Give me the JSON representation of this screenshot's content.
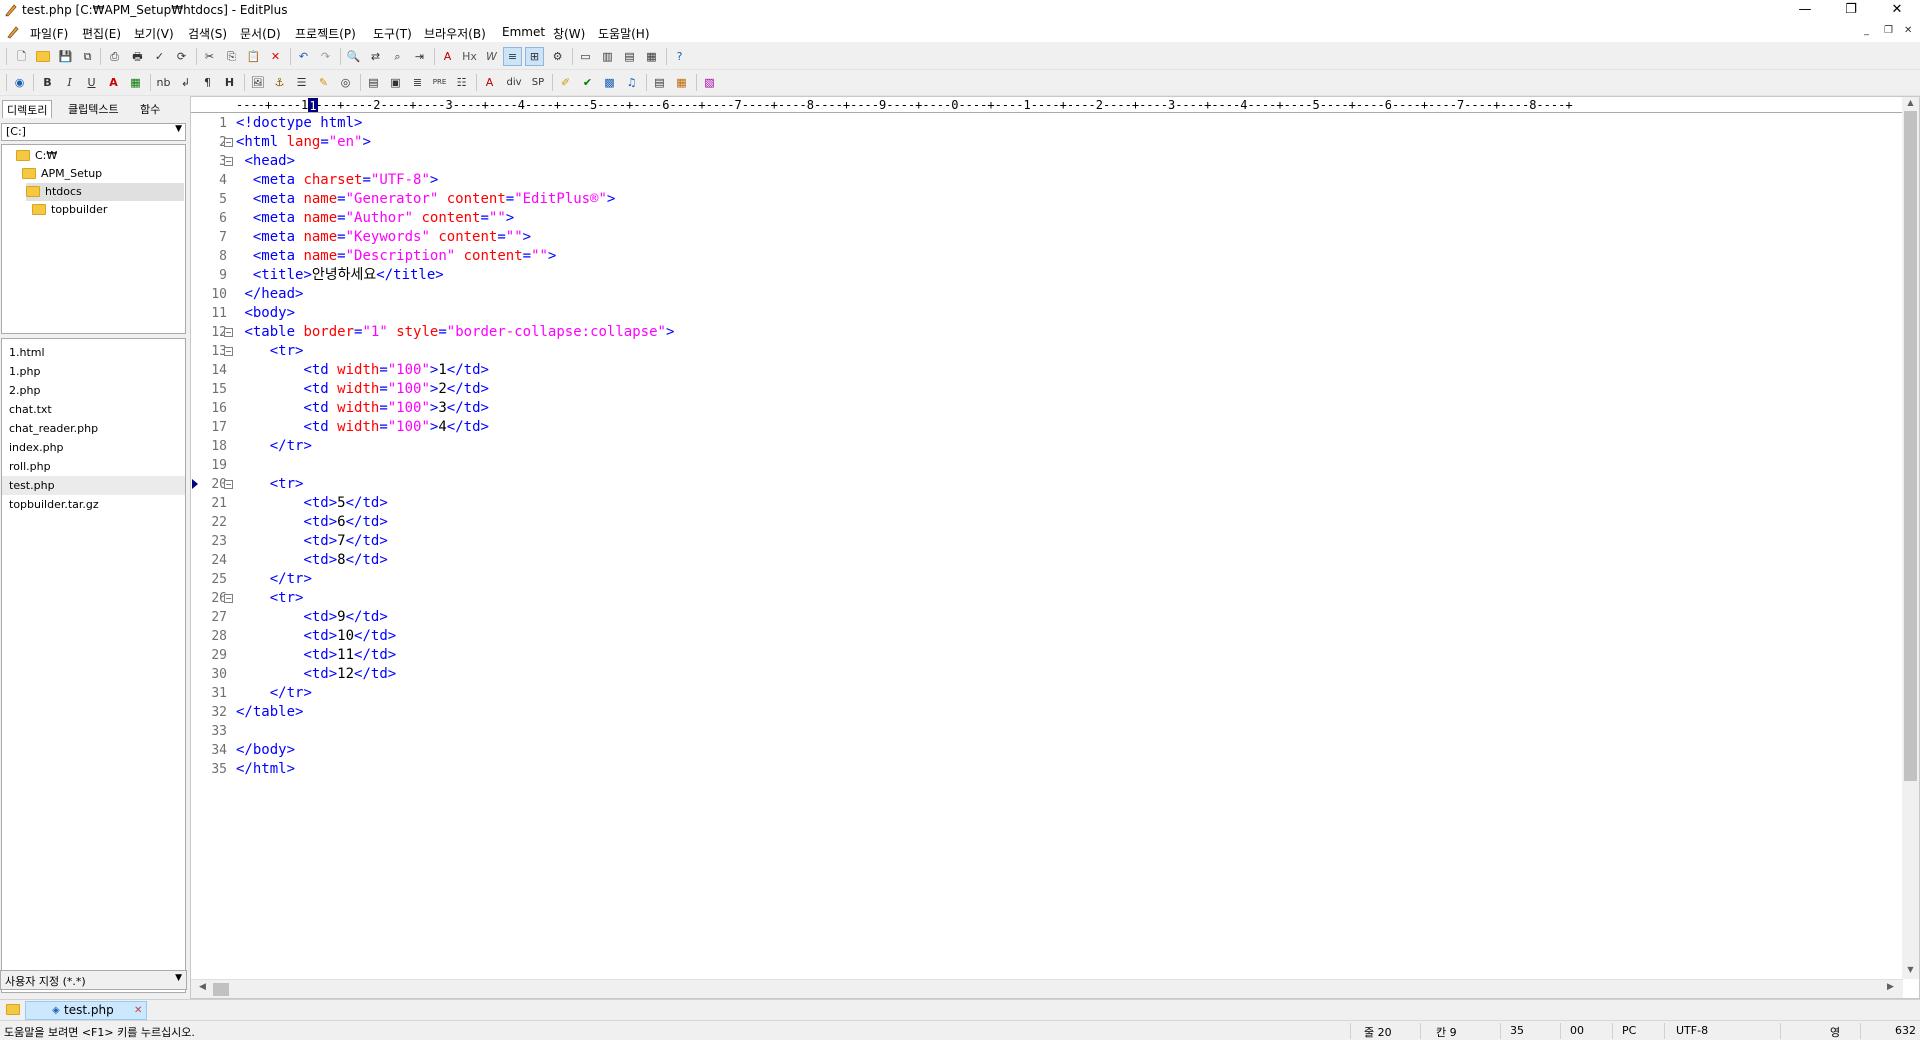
{
  "window": {
    "title": "test.php [C:₩APM_Setup₩htdocs] - EditPlus",
    "minimize": "—",
    "restore": "❐",
    "close": "✕"
  },
  "menu": [
    "파일(F)",
    "편집(E)",
    "보기(V)",
    "검색(S)",
    "문서(D)",
    "프로젝트(P)",
    "도구(T)",
    "브라우저(B)",
    "Emmet",
    "창(W)",
    "도움말(H)"
  ],
  "mdi_controls": [
    "_",
    "❐",
    "✕"
  ],
  "toolbar1_icons": [
    "new-file-icon",
    "open-file-icon",
    "save-icon",
    "save-all-icon",
    "print-preview-icon",
    "print-icon",
    "spell-check-icon",
    "sync-icon",
    "cut-icon",
    "copy-icon",
    "paste-icon",
    "delete-icon",
    "undo-icon",
    "redo-icon",
    "find-icon",
    "replace-icon",
    "find-in-files-icon",
    "go-to-icon",
    "font-icon",
    "hex-icon",
    "word-wrap-icon",
    "line-number-icon",
    "column-mode-icon",
    "settings-icon",
    "browser-icon",
    "window-split-icon",
    "cliptext-window-icon",
    "output-window-icon",
    "full-screen-icon",
    "help-icon"
  ],
  "toolbar2": {
    "bold": "B",
    "italic": "I",
    "underline": "U",
    "font_color": "A",
    "nbsp": "nb",
    "pilcrow": "¶",
    "heading": "H",
    "div": "div",
    "sp": "SP",
    "pre": "PRE"
  },
  "left_tabs": [
    "디렉토리",
    "클립텍스트",
    "함수"
  ],
  "drive": "[C:]",
  "tree": [
    "C:₩",
    "APM_Setup",
    "htdocs",
    "topbuilder"
  ],
  "files": [
    "1.html",
    "1.php",
    "2.php",
    "chat.txt",
    "chat_reader.php",
    "index.php",
    "roll.php",
    "test.php",
    "topbuilder.tar.gz"
  ],
  "selected_file": "test.php",
  "filter": "사용자 지정 (*.*)",
  "ruler": "----+----1----+----2----+----3----+----4----+----5----+----6----+----7----+----8----+----9----+----0----+----1----+----2----+----3----+----4----+----5----+----6----+----7----+----8----+",
  "ruler_cursor": "1",
  "code_lines": [
    "<!doctype html>",
    "<html lang=\"en\">",
    " <head>",
    "  <meta charset=\"UTF-8\">",
    "  <meta name=\"Generator\" content=\"EditPlus®\">",
    "  <meta name=\"Author\" content=\"\">",
    "  <meta name=\"Keywords\" content=\"\">",
    "  <meta name=\"Description\" content=\"\">",
    "  <title>안녕하세요</title>",
    " </head>",
    " <body>",
    " <table border=\"1\" style=\"border-collapse:collapse\">",
    "    <tr>",
    "        <td width=\"100\">1</td>",
    "        <td width=\"100\">2</td>",
    "        <td width=\"100\">3</td>",
    "        <td width=\"100\">4</td>",
    "    </tr>",
    "",
    "    <tr>",
    "        <td>5</td>",
    "        <td>6</td>",
    "        <td>7</td>",
    "        <td>8</td>",
    "    </tr>",
    "    <tr>",
    "        <td>9</td>",
    "        <td>10</td>",
    "        <td>11</td>",
    "        <td>12</td>",
    "    </tr>",
    "</table>",
    "",
    "</body>",
    "</html>"
  ],
  "fold_lines": [
    2,
    3,
    12,
    13,
    20,
    26
  ],
  "current_line": 20,
  "doc_tab": "test.php",
  "status": {
    "help": "도움말을 보려면 <F1> 키를 누르십시오.",
    "line": "줄 20",
    "col": "칸 9",
    "total": "35",
    "code": "00",
    "linebreak": "PC",
    "encoding": "UTF-8",
    "ime": "영",
    "size": "632"
  },
  "colors": {
    "tag": "#0000ff",
    "attribute": "#ff0000",
    "value": "#ff00ff",
    "line_number": "#707070",
    "selected_tab": "#cce8ff"
  }
}
